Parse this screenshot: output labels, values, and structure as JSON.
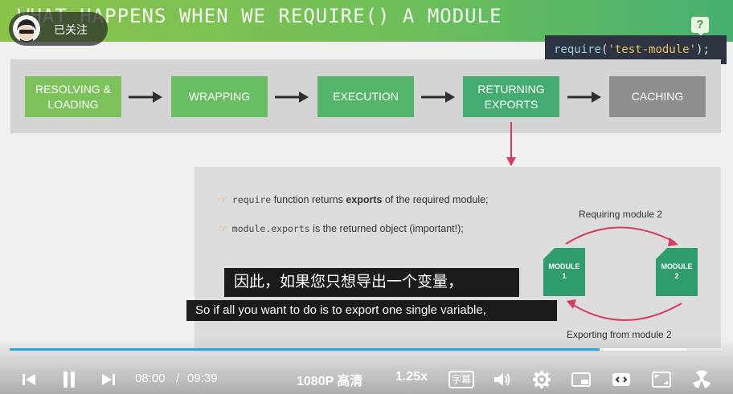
{
  "slide": {
    "title": "WHAT HAPPENS WHEN WE REQUIRE() A MODULE",
    "help_icon": "question-speech-icon",
    "code": {
      "fn": "require",
      "open": "(",
      "arg": "'test-module'",
      "close": ");"
    },
    "flow_steps": [
      "RESOLVING &",
      "LOADING",
      "WRAPPING",
      "EXECUTION",
      "RETURNING",
      "EXPORTS",
      "CACHING"
    ],
    "flow": [
      {
        "line1": "RESOLVING &",
        "line2": "LOADING"
      },
      {
        "line1": "WRAPPING",
        "line2": ""
      },
      {
        "line1": "EXECUTION",
        "line2": ""
      },
      {
        "line1": "RETURNING",
        "line2": "EXPORTS"
      },
      {
        "line1": "CACHING",
        "line2": ""
      }
    ],
    "bullets": [
      {
        "code": "require",
        "before": " function returns ",
        "bold": "exports",
        "after": " of the required module;"
      },
      {
        "code": "module.exports",
        "before": " is the returned object (important!);",
        "bold": "",
        "after": ""
      }
    ],
    "diagram": {
      "top_label": "Requiring module 2",
      "bottom_label": "Exporting from module 2",
      "module1": {
        "line1": "MODULE",
        "line2": "1"
      },
      "module2": {
        "line1": "MODULE",
        "line2": "2"
      }
    },
    "colors": {
      "header_start": "#8bc34a",
      "header_end": "#46b070",
      "arrow_red": "#d63c5e",
      "module_green": "#2e9c6e"
    }
  },
  "overlay": {
    "follow_label": "已关注",
    "subtitle_cn": "因此，如果您只想导出一个变量，",
    "subtitle_en": "So if all you want to do is to export one single variable,"
  },
  "player": {
    "current_time": "08:00",
    "separator": "/",
    "duration": "09:39",
    "progress_fraction": 0.828,
    "buffered_fraction": 0.95,
    "quality": "1080P 高清",
    "speed": "1.25x",
    "subtitle_label": "字幕",
    "accent_color": "#28a7e0"
  }
}
